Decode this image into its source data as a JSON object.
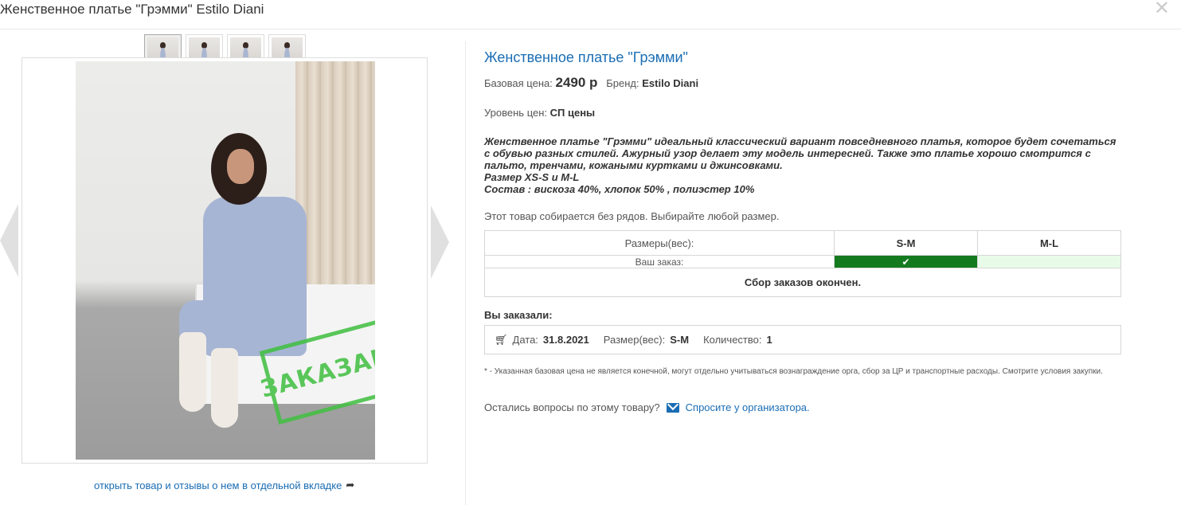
{
  "modal": {
    "title": "Женственное платье \"Грэмми\" Estilo Diani",
    "close": "✕"
  },
  "gallery": {
    "thumbnails": [
      "thumb-1",
      "thumb-2",
      "thumb-3",
      "thumb-4"
    ],
    "stamp_text": "ЗАКАЗАНО",
    "open_link": "открыть товар и отзывы о нем в отдельной вкладке",
    "open_icon": "➦"
  },
  "product": {
    "title": "Женственное платье \"Грэмми\"",
    "base_price_label": "Базовая цена:",
    "base_price": "2490 р",
    "brand_label": "Бренд:",
    "brand": "Estilo Diani",
    "price_level_label": "Уровень цен:",
    "price_level": "СП цены",
    "description": [
      "Женственное платье \"Грэмми\" идеальный классический вариант повседневного платья, которое будет сочетаться",
      "с обувью разных стилей. Ажурный узор делает эту модель интересней. Также это платье хорошо смотрится с",
      "пальто, тренчами, кожаными куртками и джинсовками.",
      "Размер XS-S и M-L",
      "Состав : вискоза 40%, хлопок 50% , полиэстер 10%"
    ],
    "note": "Этот товар собирается без рядов. Выбирайте любой размер."
  },
  "sizes_table": {
    "sizes_label": "Размеры(вес):",
    "your_order_label": "Ваш заказ:",
    "sizes": [
      "S-M",
      "M-L"
    ],
    "selected_size": "S-M",
    "selected_mark": "✔",
    "status": "Сбор заказов окончен."
  },
  "ordered": {
    "heading": "Вы заказали:",
    "date_label": "Дата:",
    "date": "31.8.2021",
    "size_label": "Размер(вес):",
    "size": "S-M",
    "qty_label": "Количество:",
    "qty": "1"
  },
  "footnote": "* - Указанная базовая цена не является конечной, могут отдельно учитываться вознаграждение орга, сбор за ЦР и транспортные расходы. Смотрите условия закупки.",
  "ask": {
    "question": "Остались вопросы по этому товару?",
    "link": "Спросите у организатора."
  },
  "colors": {
    "link": "#1a6db4",
    "selected": "#137a1e",
    "available": "#e8fbe8",
    "stamp": "#3fbf3f"
  }
}
